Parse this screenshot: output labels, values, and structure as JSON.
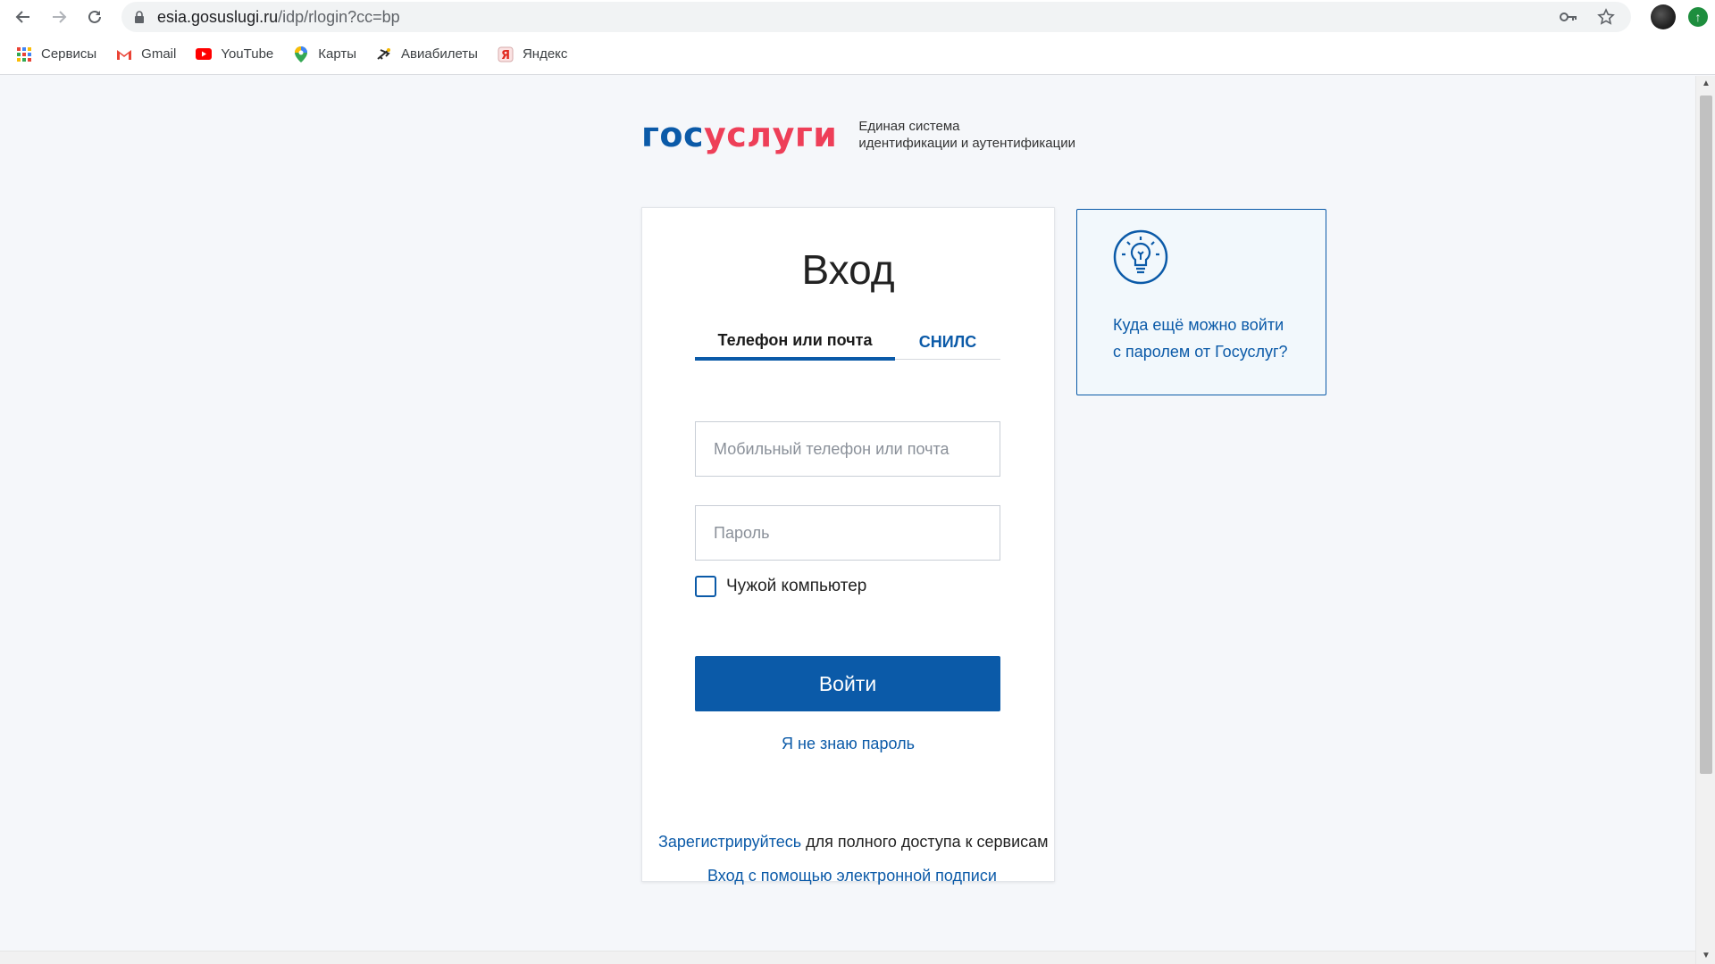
{
  "browser": {
    "url_host": "esia.gosuslugi.ru",
    "url_path": "/idp/rlogin?cc=bp",
    "bookmarks": [
      {
        "label": "Сервисы",
        "icon": "apps-grid-icon"
      },
      {
        "label": "Gmail",
        "icon": "gmail-icon"
      },
      {
        "label": "YouTube",
        "icon": "youtube-icon"
      },
      {
        "label": "Карты",
        "icon": "maps-pin-icon"
      },
      {
        "label": "Авиабилеты",
        "icon": "plane-icon"
      },
      {
        "label": "Яндекс",
        "icon": "yandex-icon"
      }
    ]
  },
  "header": {
    "logo_part1": "гос",
    "logo_part2": "услуги",
    "subtitle_line1": "Единая система",
    "subtitle_line2": "идентификации и аутентификации"
  },
  "login": {
    "title": "Вход",
    "tabs": [
      {
        "label": "Телефон или почта",
        "active": true
      },
      {
        "label": "СНИЛС",
        "active": false
      }
    ],
    "login_placeholder": "Мобильный телефон или почта",
    "login_value": "",
    "password_placeholder": "Пароль",
    "password_value": "",
    "checkbox_label": "Чужой компьютер",
    "checkbox_checked": false,
    "submit_label": "Войти",
    "forgot_label": "Я не знаю пароль"
  },
  "info": {
    "icon": "lightbulb-icon",
    "text_line1": "Куда ещё можно войти",
    "text_line2": "с паролем от Госуслуг?"
  },
  "footer": {
    "register_link": "Зарегистрируйтесь",
    "register_rest": " для полного доступа к сервисам",
    "esign_link": "Вход с помощью электронной подписи"
  },
  "colors": {
    "brand_blue": "#0b5aa8",
    "brand_red": "#ee3f58",
    "page_bg": "#f5f7fa"
  }
}
